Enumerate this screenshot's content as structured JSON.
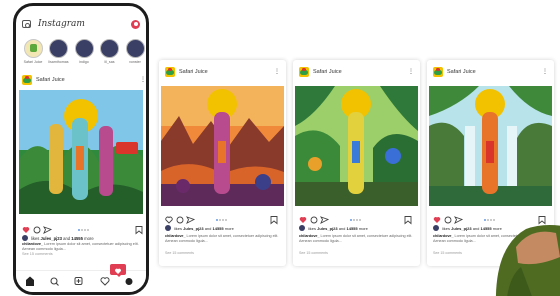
{
  "phone": {
    "app_name": "Instagram",
    "stories": [
      {
        "label": "Safari Juice",
        "own": true
      },
      {
        "label": "lisamthomas",
        "own": false
      },
      {
        "label": "indigo",
        "own": false
      },
      {
        "label": "lil_sas",
        "own": false
      },
      {
        "label": "vonster",
        "own": false
      }
    ],
    "post": {
      "account": "Safari Juice",
      "likes_prefix": "likes ",
      "likes_user": "Jules_pj23",
      "likes_mid": " and ",
      "likes_count": "14555",
      "likes_suffix": " more",
      "caption_user": "chilardove_",
      "caption_text": "Lorem ipsum dolor sit amet, consectetuer adipiscing elit. Aenean commodo ligula...",
      "comments": "See 15 comments"
    }
  },
  "cards": [
    {
      "account": "Safari Juice",
      "likes_prefix": "likes ",
      "likes_user": "Jules_pj23",
      "likes_mid": " and ",
      "likes_count": "14555",
      "likes_suffix": " more",
      "caption_user": "chilardove_",
      "caption_text": "Lorem ipsum dolor sit amet, consectetuer adipiscing elit. Aenean commodo ligula...",
      "comments": "See 15 comments",
      "liked": false
    },
    {
      "account": "Safari Juice",
      "likes_prefix": "likes ",
      "likes_user": "Jules_pj23",
      "likes_mid": " and ",
      "likes_count": "14555",
      "likes_suffix": " more",
      "caption_user": "chilardove_",
      "caption_text": "Lorem ipsum dolor sit amet, consectetuer adipiscing elit. Aenean commodo ligula...",
      "comments": "See 15 comments",
      "liked": true
    },
    {
      "account": "Safari Juice",
      "likes_prefix": "likes ",
      "likes_user": "Jules_pj23",
      "likes_mid": " and ",
      "likes_count": "14555",
      "likes_suffix": " more",
      "caption_user": "chilardove_",
      "caption_text": "Lorem ipsum dolor sit amet, consectetuer adipiscing elit. Aenean commodo ligula...",
      "comments": "See 15 comments",
      "liked": true
    }
  ],
  "brand_logo_text": "SAFARI JUICE",
  "colors": {
    "like_red": "#e03e52",
    "brand_yellow": "#f2c200",
    "story_navy": "#3a3f66",
    "sky_blue": "#7fc6e8",
    "sunset_orange": "#e8742a",
    "jungle_green": "#3b8a3a"
  }
}
